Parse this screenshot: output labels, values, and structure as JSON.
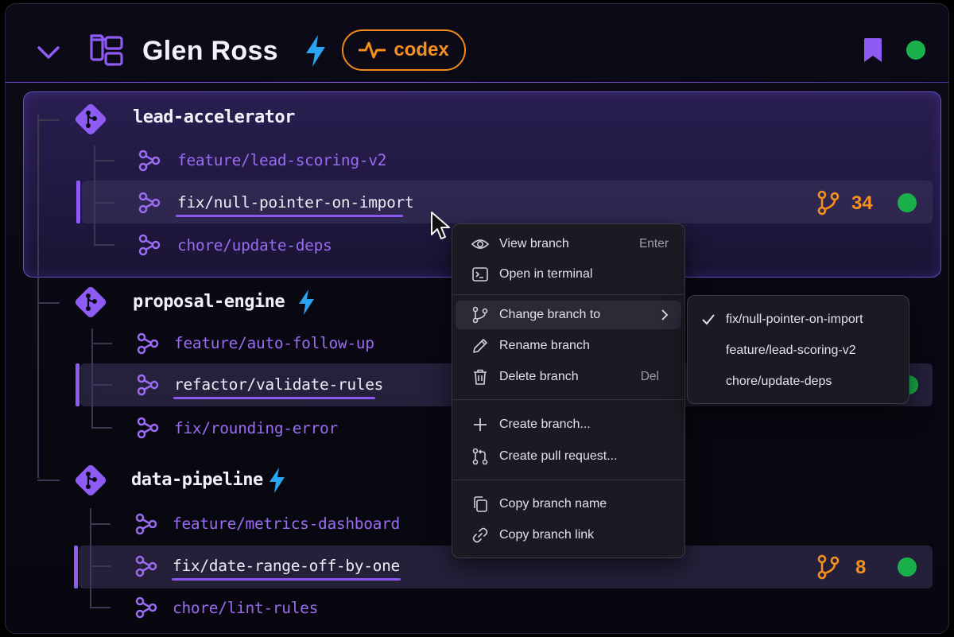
{
  "header": {
    "project_title": "Glen Ross",
    "agent_badge": "codex",
    "colors": {
      "accent": "#8e5cf5",
      "badge": "#f5901e",
      "bolt": "#2ba4f0",
      "status_ok": "#19b04b"
    }
  },
  "repos": [
    {
      "name": "lead-accelerator",
      "bolt": false,
      "branches": [
        {
          "name": "feature/lead-scoring-v2",
          "active": false
        },
        {
          "name": "fix/null-pointer-on-import",
          "active": true,
          "changes": "34",
          "status": "ok"
        },
        {
          "name": "chore/update-deps",
          "active": false
        }
      ]
    },
    {
      "name": "proposal-engine",
      "bolt": true,
      "branches": [
        {
          "name": "feature/auto-follow-up",
          "active": false
        },
        {
          "name": "refactor/validate-rules",
          "active": true,
          "status": "ok"
        },
        {
          "name": "fix/rounding-error",
          "active": false
        }
      ]
    },
    {
      "name": "data-pipeline",
      "bolt": true,
      "branches": [
        {
          "name": "feature/metrics-dashboard",
          "active": false
        },
        {
          "name": "fix/date-range-off-by-one",
          "active": true,
          "changes": "8",
          "status": "ok"
        },
        {
          "name": "chore/lint-rules",
          "active": false
        }
      ]
    }
  ],
  "context_menu": {
    "items": [
      {
        "label": "View branch",
        "shortcut": "Enter",
        "icon": "eye-icon"
      },
      {
        "label": "Open in terminal",
        "shortcut": "",
        "icon": "terminal-icon"
      },
      {
        "label": "Change branch to",
        "shortcut": "",
        "icon": "branch-icon",
        "submenu": true
      },
      {
        "label": "Rename branch",
        "shortcut": "",
        "icon": "pencil-icon"
      },
      {
        "label": "Delete branch",
        "shortcut": "Del",
        "icon": "trash-icon"
      },
      {
        "label": "Create branch...",
        "shortcut": "",
        "icon": "plus-icon"
      },
      {
        "label": "Create pull request...",
        "shortcut": "",
        "icon": "pull-request-icon"
      },
      {
        "label": "Copy branch name",
        "shortcut": "",
        "icon": "copy-icon"
      },
      {
        "label": "Copy branch link",
        "shortcut": "",
        "icon": "link-icon"
      }
    ]
  },
  "submenu": {
    "items": [
      {
        "label": "fix/null-pointer-on-import",
        "checked": true
      },
      {
        "label": "feature/lead-scoring-v2",
        "checked": false
      },
      {
        "label": "chore/update-deps",
        "checked": false
      }
    ]
  }
}
